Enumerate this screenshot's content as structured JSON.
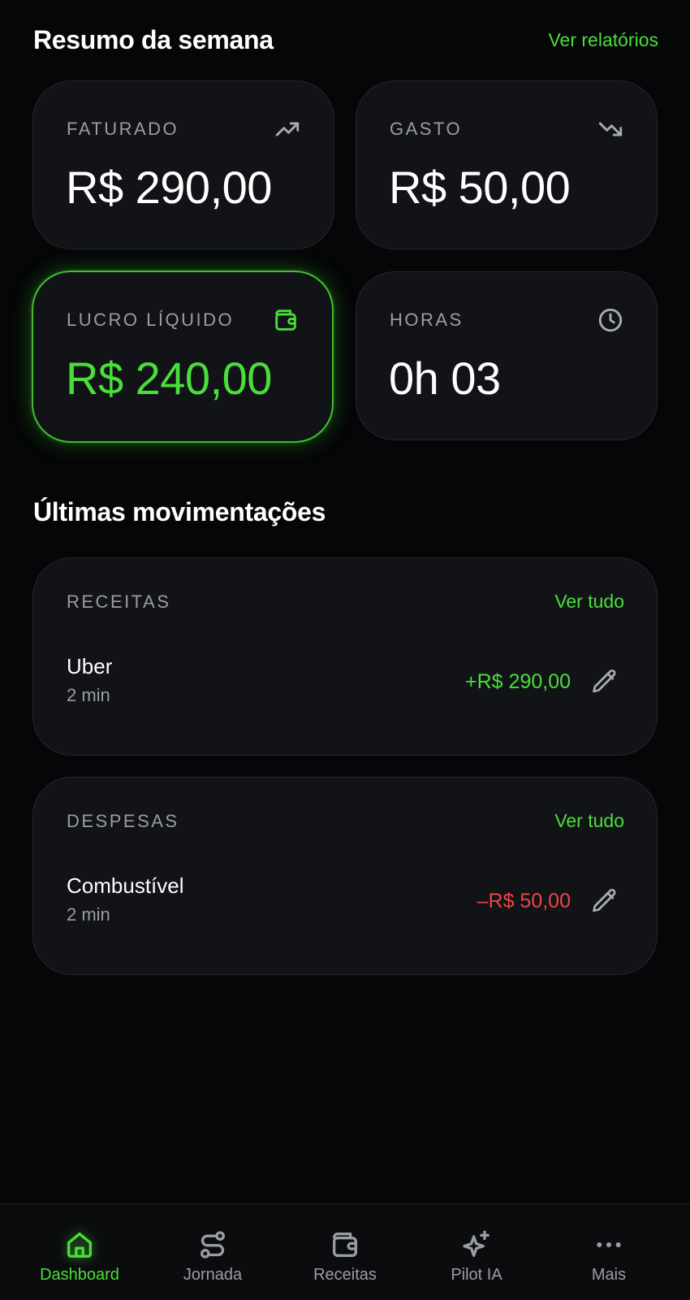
{
  "header": {
    "title": "Resumo da semana",
    "reports_link": "Ver relatórios"
  },
  "stats": {
    "billed": {
      "label": "FATURADO",
      "value": "R$ 290,00",
      "icon": "trending-up-icon"
    },
    "spent": {
      "label": "GASTO",
      "value": "R$ 50,00",
      "icon": "trending-down-icon"
    },
    "net_profit": {
      "label": "LUCRO LÍQUIDO",
      "value": "R$ 240,00",
      "icon": "wallet-icon"
    },
    "hours": {
      "label": "HORAS",
      "value": "0h 03",
      "icon": "clock-icon"
    }
  },
  "movements": {
    "title": "Últimas movimentações",
    "income": {
      "label": "RECEITAS",
      "see_all": "Ver tudo",
      "items": [
        {
          "name": "Uber",
          "time": "2 min",
          "amount": "+R$ 290,00"
        }
      ]
    },
    "expenses": {
      "label": "DESPESAS",
      "see_all": "Ver tudo",
      "items": [
        {
          "name": "Combustível",
          "time": "2 min",
          "amount": "–R$ 50,00"
        }
      ]
    }
  },
  "tabbar": {
    "items": [
      {
        "label": "Dashboard",
        "icon": "home-icon",
        "active": true
      },
      {
        "label": "Jornada",
        "icon": "route-icon",
        "active": false
      },
      {
        "label": "Receitas",
        "icon": "wallet-icon",
        "active": false
      },
      {
        "label": "Pilot IA",
        "icon": "sparkles-icon",
        "active": false
      },
      {
        "label": "Mais",
        "icon": "more-icon",
        "active": false
      }
    ]
  },
  "colors": {
    "accent": "#4ade3a",
    "negative": "#ef4444",
    "background": "#050607",
    "card": "#111317",
    "muted_text": "#9a9da3"
  }
}
